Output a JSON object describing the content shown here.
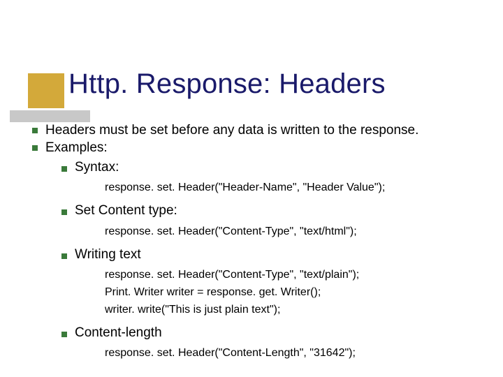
{
  "title": "Http. Response: Headers",
  "bullets": {
    "b1": "Headers must be set before any data is written to the response.",
    "b2": "Examples:",
    "sub1": "Syntax:",
    "code1": "response. set. Header(\"Header-Name\",  \"Header  Value\");",
    "sub2": "Set Content type:",
    "code2": "response. set. Header(\"Content-Type\",  \"text/html\");",
    "sub3": "Writing  text",
    "code3a": "response. set. Header(\"Content-Type\",  \"text/plain\");",
    "code3b": "Print. Writer  writer  = response. get. Writer();",
    "code3c": "writer. write(\"This is just plain text\");",
    "sub4": "Content-length",
    "code4": "response. set. Header(\"Content-Length\",  \"31642\");"
  }
}
